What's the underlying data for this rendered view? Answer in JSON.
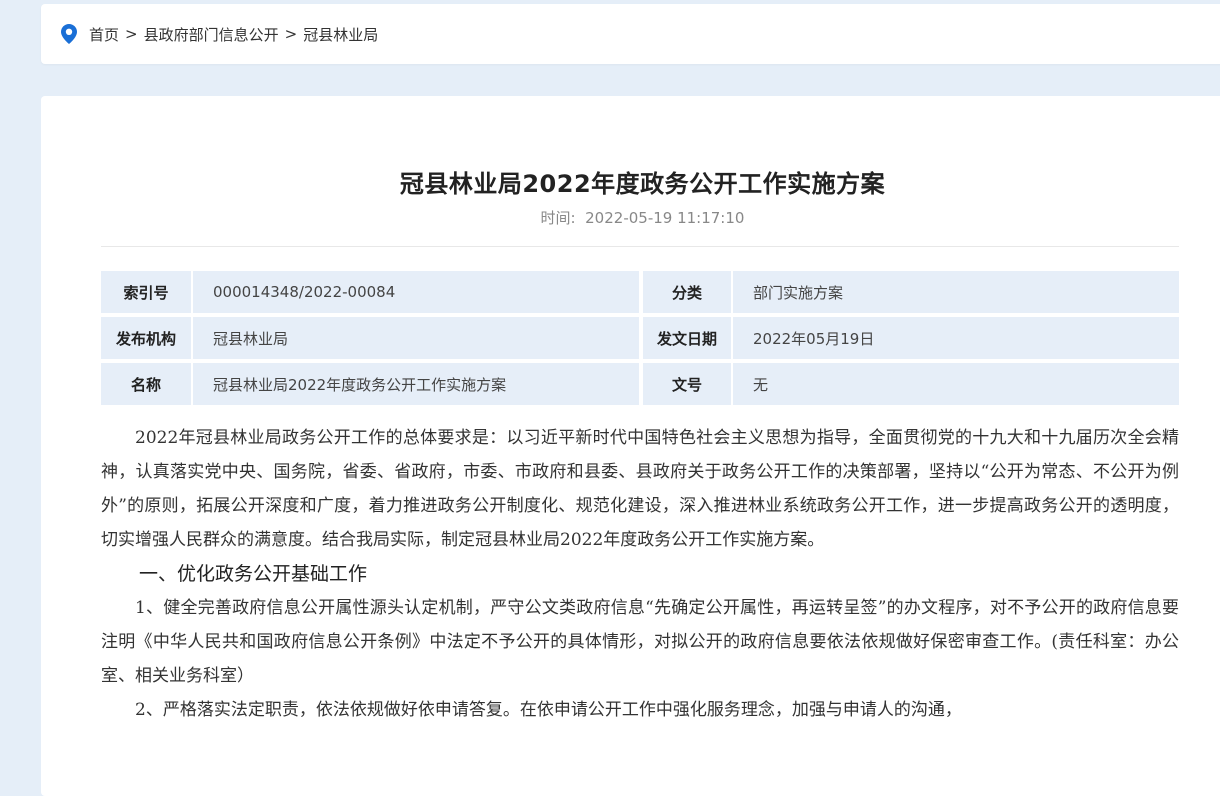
{
  "breadcrumb": {
    "items": [
      "首页",
      "县政府部门信息公开",
      "冠县林业局"
    ],
    "separator": ">"
  },
  "article": {
    "title": "冠县林业局2022年度政务公开工作实施方案",
    "time_label": "时间:",
    "time_value": "2022-05-19 11:17:10"
  },
  "meta": {
    "rows": [
      {
        "k1": "索引号",
        "v1": "000014348/2022-00084",
        "k2": "分类",
        "v2": "部门实施方案"
      },
      {
        "k1": "发布机构",
        "v1": "冠县林业局",
        "k2": "发文日期",
        "v2": "2022年05月19日"
      },
      {
        "k1": "名称",
        "v1": "冠县林业局2022年度政务公开工作实施方案",
        "k2": "文号",
        "v2": "无"
      }
    ]
  },
  "content": {
    "p1": "2022年冠县林业局政务公开工作的总体要求是：以习近平新时代中国特色社会主义思想为指导，全面贯彻党的十九大和十九届历次全会精神，认真落实党中央、国务院，省委、省政府，市委、市政府和县委、县政府关于政务公开工作的决策部署，坚持以“公开为常态、不公开为例外”的原则，拓展公开深度和广度，着力推进政务公开制度化、规范化建设，深入推进林业系统政务公开工作，进一步提高政务公开的透明度，切实增强人民群众的满意度。结合我局实际，制定冠县林业局2022年度政务公开工作实施方案。",
    "h1": "一、优化政务公开基础工作",
    "p2": "1、健全完善政府信息公开属性源头认定机制，严守公文类政府信息“先确定公开属性，再运转呈签”的办文程序，对不予公开的政府信息要注明《中华人民共和国政府信息公开条例》中法定不予公开的具体情形，对拟公开的政府信息要依法依规做好保密审查工作。(责任科室：办公室、相关业务科室）",
    "p3": "2、严格落实法定职责，依法依规做好依申请答复。在依申请公开工作中强化服务理念，加强与申请人的沟通，"
  },
  "colors": {
    "page_bg": "#e5eef8",
    "table_bg": "#e6eef8",
    "pin": "#1a6fd6"
  },
  "icons": {
    "location": "location-pin-icon"
  }
}
